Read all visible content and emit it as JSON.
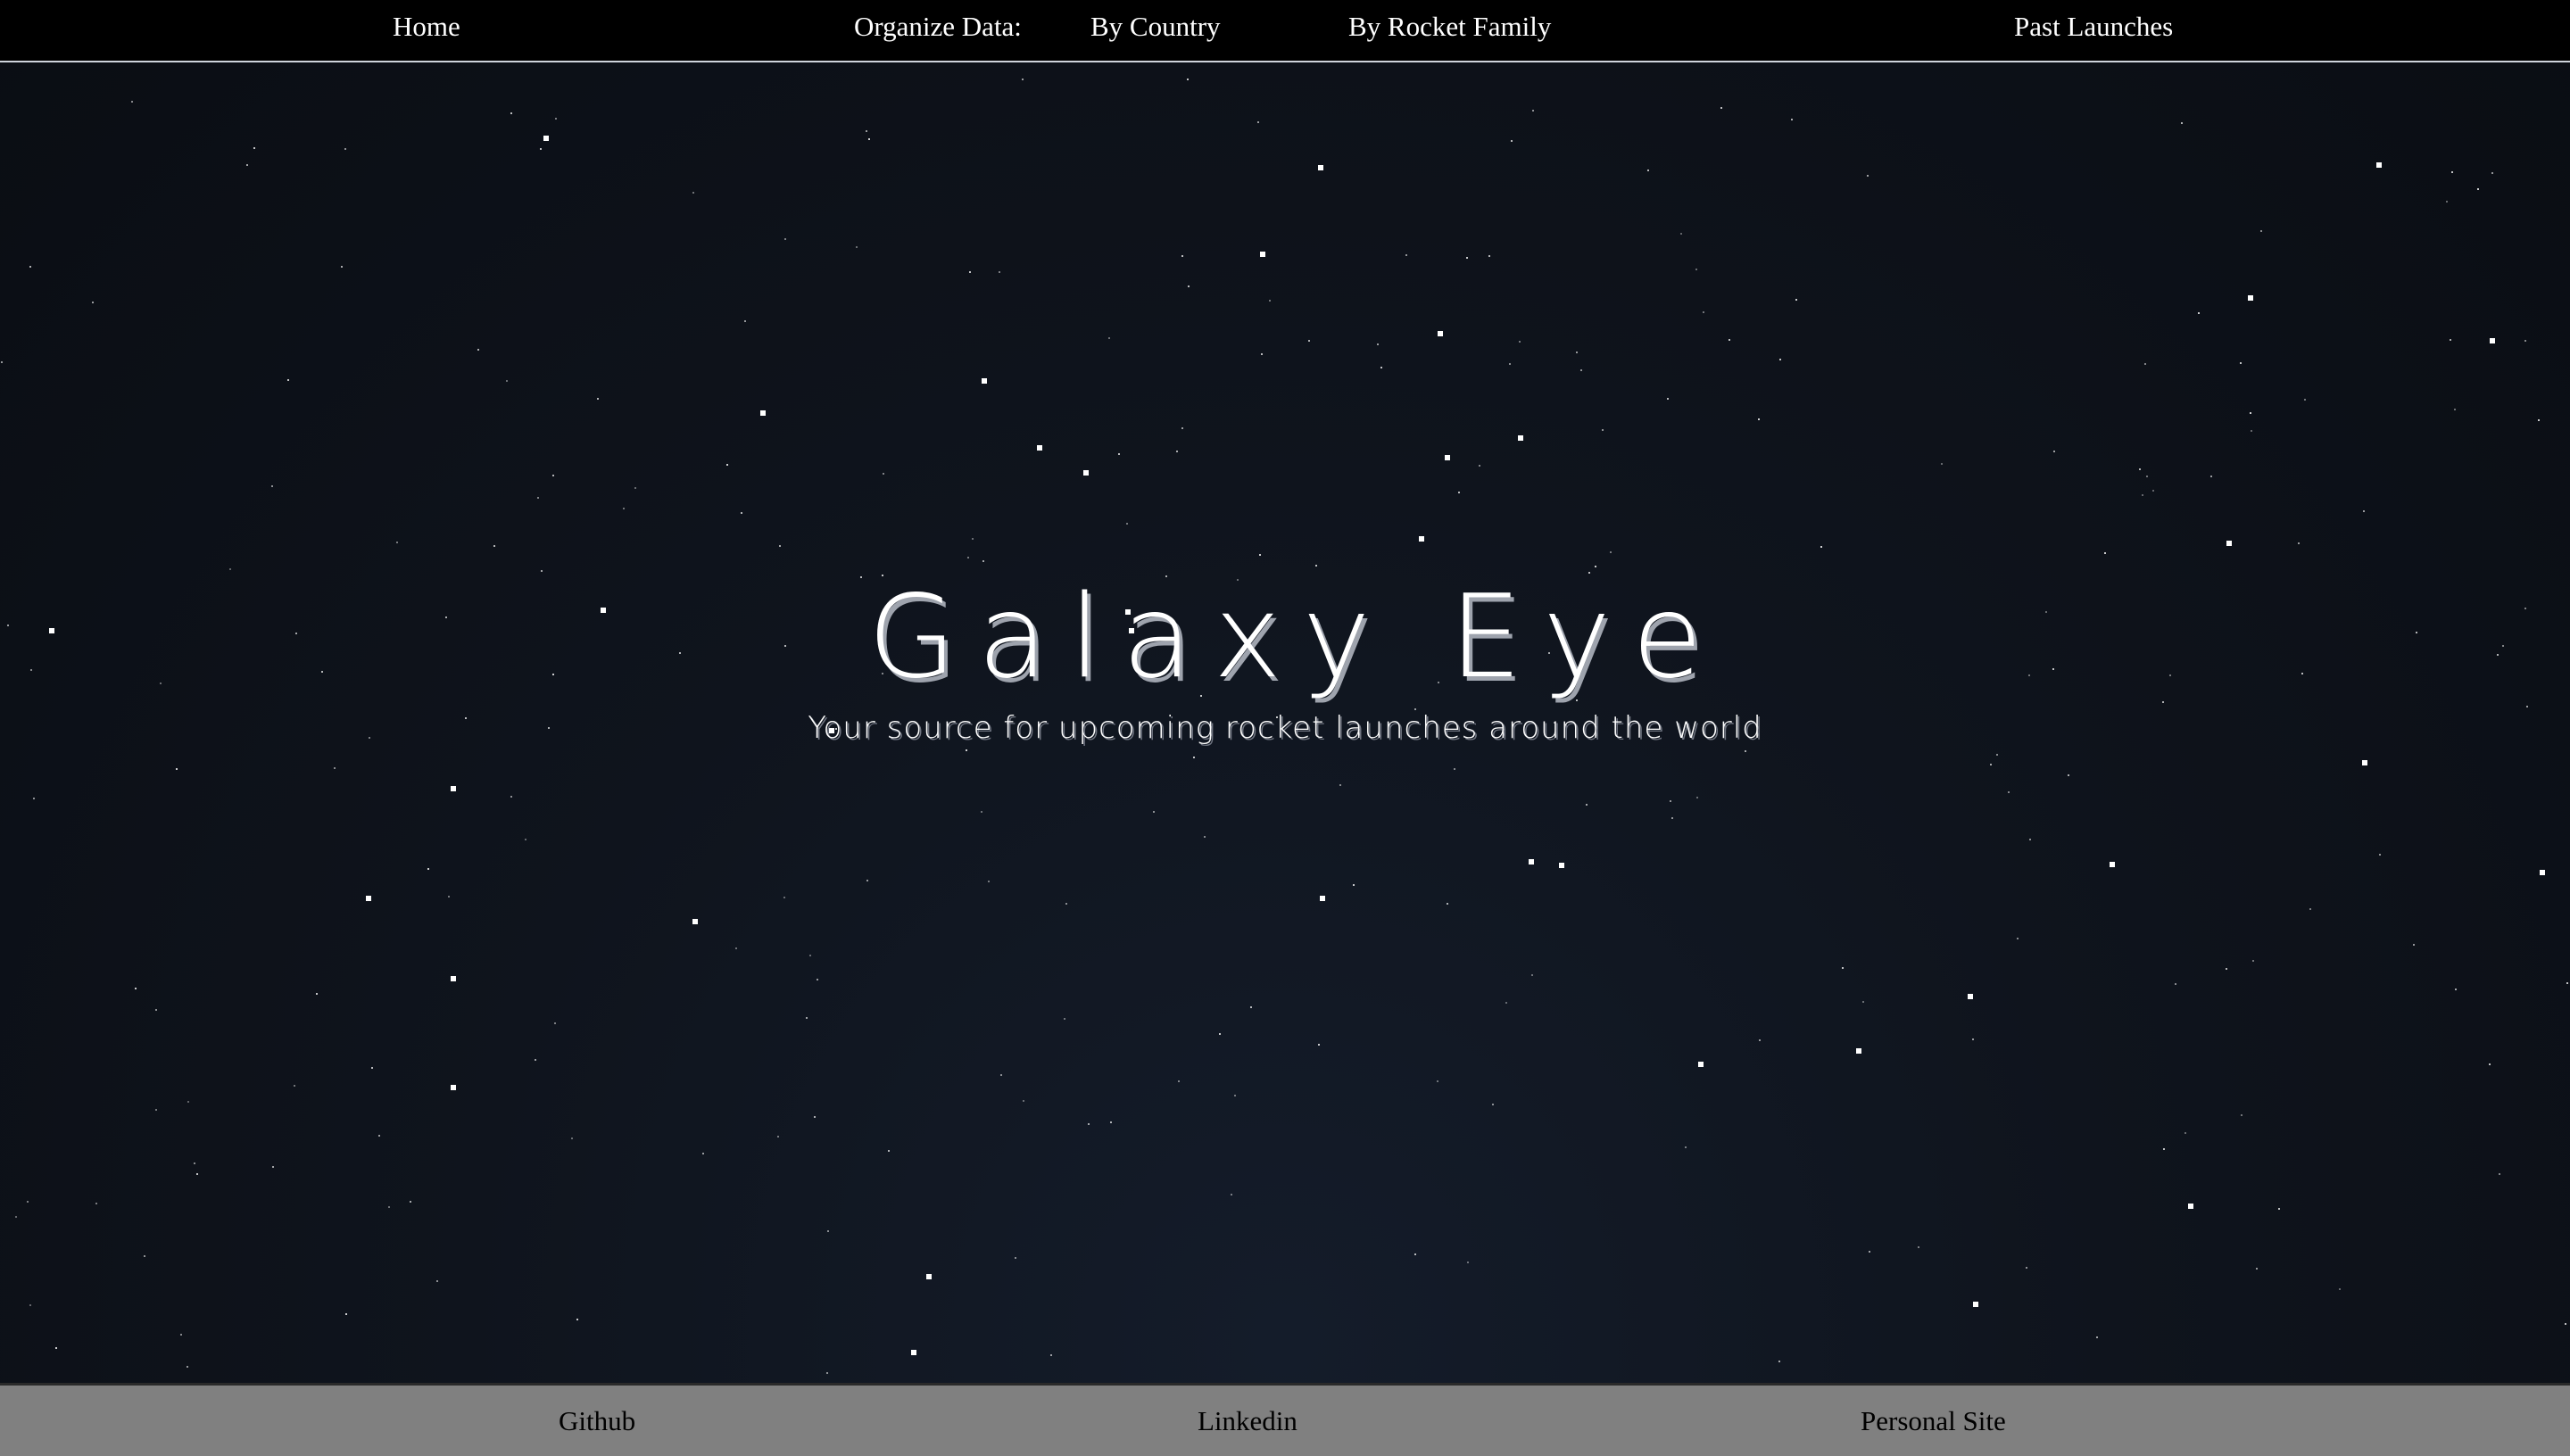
{
  "nav": {
    "home": "Home",
    "organize_label": "Organize Data:",
    "by_country": "By Country",
    "by_rocket_family": "By Rocket Family",
    "past_launches": "Past Launches"
  },
  "hero": {
    "title": "Galaxy Eye",
    "subtitle": "Your source for upcoming rocket launches around the world"
  },
  "footer": {
    "github": "Github",
    "linkedin": "Linkedin",
    "personal_site": "Personal Site"
  },
  "colors": {
    "background": "#0b0e14",
    "navbar": "#000000",
    "footer": "#808080",
    "text_light": "#ffffff",
    "text_dark": "#000000"
  }
}
